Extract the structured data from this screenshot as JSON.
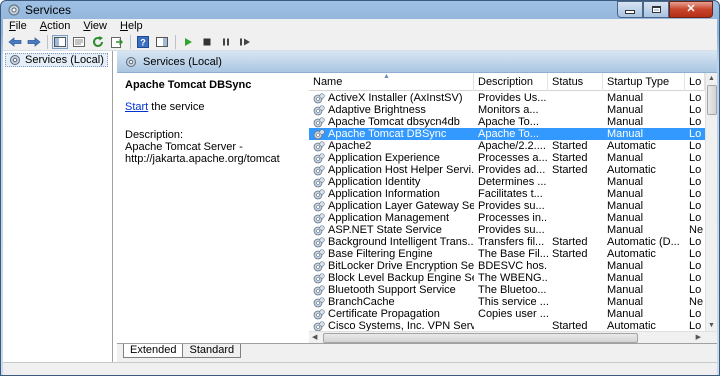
{
  "window": {
    "title": "Services",
    "controls": [
      "minimize",
      "maximize",
      "close"
    ]
  },
  "menu": {
    "items": [
      "File",
      "Action",
      "View",
      "Help"
    ]
  },
  "toolbar": {
    "icons": [
      "back-arrow-icon",
      "forward-arrow-icon",
      "show-hide-tree-icon",
      "properties-icon",
      "refresh-icon",
      "export-list-icon",
      "help-icon",
      "show-action-pane-icon",
      "start-service-icon",
      "stop-service-icon",
      "pause-service-icon",
      "restart-service-icon"
    ]
  },
  "tree": {
    "item": "Services (Local)"
  },
  "header": {
    "title": "Services (Local)"
  },
  "extended": {
    "service_title": "Apache Tomcat DBSync",
    "start_link": "Start",
    "start_suffix": " the service",
    "description_label": "Description:",
    "description_text": "Apache Tomcat Server - http://jakarta.apache.org/tomcat"
  },
  "list": {
    "columns": [
      "Name",
      "Description",
      "Status",
      "Startup Type",
      "Lo"
    ],
    "selected_index": 3,
    "rows": [
      {
        "name": "ActiveX Installer (AxInstSV)",
        "desc": "Provides Us...",
        "status": "",
        "startup": "Manual",
        "log": "Lo"
      },
      {
        "name": "Adaptive Brightness",
        "desc": "Monitors a...",
        "status": "",
        "startup": "Manual",
        "log": "Lo"
      },
      {
        "name": "Apache Tomcat dbsycn4db",
        "desc": "Apache To...",
        "status": "",
        "startup": "Manual",
        "log": "Lo"
      },
      {
        "name": "Apache Tomcat DBSync",
        "desc": "Apache To...",
        "status": "",
        "startup": "Manual",
        "log": "Lo"
      },
      {
        "name": "Apache2",
        "desc": "Apache/2.2....",
        "status": "Started",
        "startup": "Automatic",
        "log": "Lo"
      },
      {
        "name": "Application Experience",
        "desc": "Processes a...",
        "status": "Started",
        "startup": "Manual",
        "log": "Lo"
      },
      {
        "name": "Application Host Helper Servi...",
        "desc": "Provides ad...",
        "status": "Started",
        "startup": "Automatic",
        "log": "Lo"
      },
      {
        "name": "Application Identity",
        "desc": "Determines ...",
        "status": "",
        "startup": "Manual",
        "log": "Lo"
      },
      {
        "name": "Application Information",
        "desc": "Facilitates t...",
        "status": "",
        "startup": "Manual",
        "log": "Lo"
      },
      {
        "name": "Application Layer Gateway Se...",
        "desc": "Provides su...",
        "status": "",
        "startup": "Manual",
        "log": "Lo"
      },
      {
        "name": "Application Management",
        "desc": "Processes in...",
        "status": "",
        "startup": "Manual",
        "log": "Lo"
      },
      {
        "name": "ASP.NET State Service",
        "desc": "Provides su...",
        "status": "",
        "startup": "Manual",
        "log": "Ne"
      },
      {
        "name": "Background Intelligent Trans...",
        "desc": "Transfers fil...",
        "status": "Started",
        "startup": "Automatic (D...",
        "log": "Lo"
      },
      {
        "name": "Base Filtering Engine",
        "desc": "The Base Fil...",
        "status": "Started",
        "startup": "Automatic",
        "log": "Lo"
      },
      {
        "name": "BitLocker Drive Encryption Se...",
        "desc": "BDESVC hos...",
        "status": "",
        "startup": "Manual",
        "log": "Lo"
      },
      {
        "name": "Block Level Backup Engine Se...",
        "desc": "The WBENG...",
        "status": "",
        "startup": "Manual",
        "log": "Lo"
      },
      {
        "name": "Bluetooth Support Service",
        "desc": "The Bluetoo...",
        "status": "",
        "startup": "Manual",
        "log": "Lo"
      },
      {
        "name": "BranchCache",
        "desc": "This service ...",
        "status": "",
        "startup": "Manual",
        "log": "Ne"
      },
      {
        "name": "Certificate Propagation",
        "desc": "Copies user ...",
        "status": "",
        "startup": "Manual",
        "log": "Lo"
      },
      {
        "name": "Cisco Systems, Inc. VPN Servi...",
        "desc": "",
        "status": "Started",
        "startup": "Automatic",
        "log": "Lo"
      }
    ]
  },
  "tabs": [
    "Extended",
    "Standard"
  ],
  "active_tab": "Extended",
  "colors": {
    "selection": "#3399ff",
    "link": "#0033cc",
    "header_band": "#aac6e2"
  }
}
